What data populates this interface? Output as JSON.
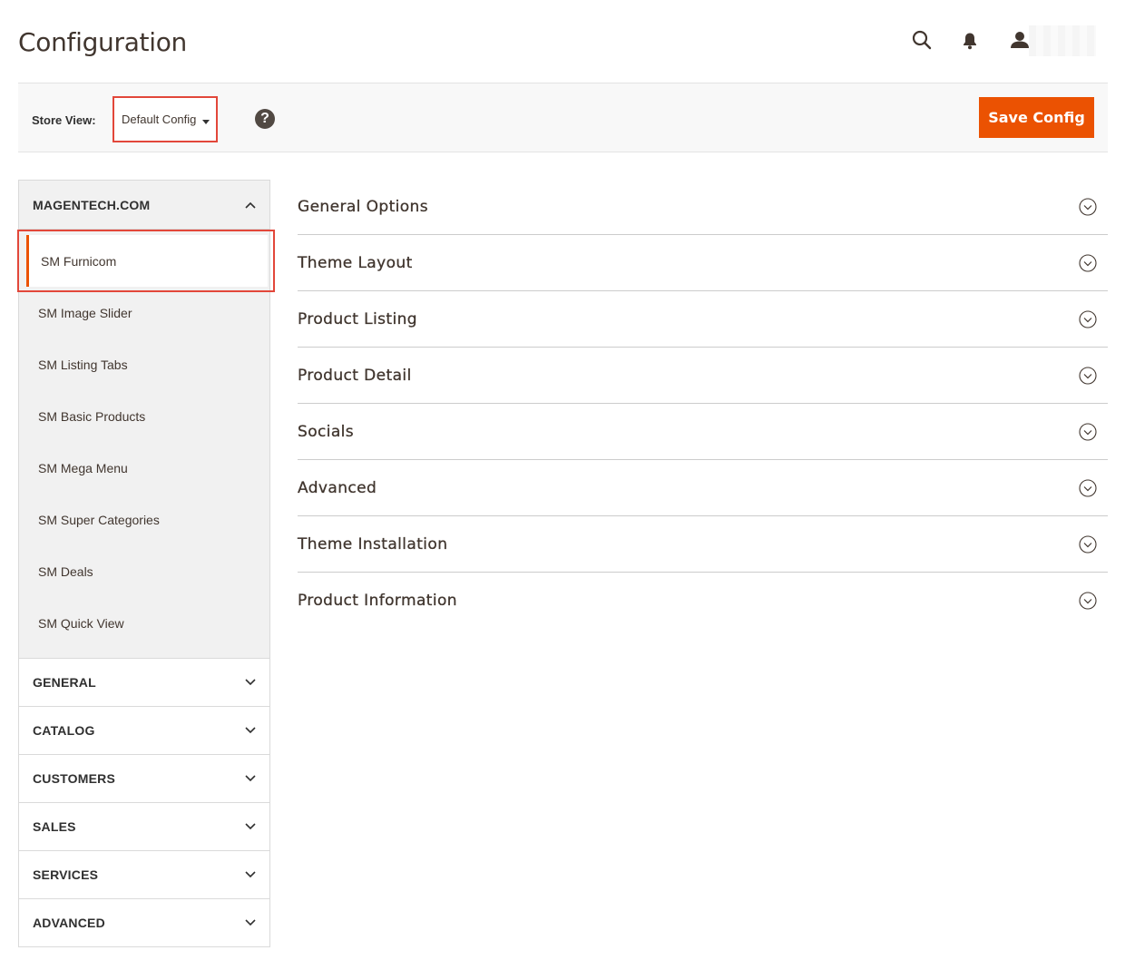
{
  "header": {
    "title": "Configuration",
    "icons": [
      "search-icon",
      "bell-icon",
      "user-icon"
    ]
  },
  "store_bar": {
    "label": "Store View:",
    "selected_scope": "Default Config",
    "help_symbol": "?",
    "save_label": "Save Config",
    "accent_color": "#eb5202",
    "highlight_color": "#e2473a"
  },
  "sidebar": {
    "open_section": {
      "title": "MAGENTECH.COM",
      "items": [
        {
          "label": "SM Furnicom",
          "active": true
        },
        {
          "label": "SM Image Slider"
        },
        {
          "label": "SM Listing Tabs"
        },
        {
          "label": "SM Basic Products"
        },
        {
          "label": "SM Mega Menu"
        },
        {
          "label": "SM Super Categories"
        },
        {
          "label": "SM Deals"
        },
        {
          "label": "SM Quick View"
        }
      ]
    },
    "sections": [
      {
        "title": "GENERAL"
      },
      {
        "title": "CATALOG"
      },
      {
        "title": "CUSTOMERS"
      },
      {
        "title": "SALES"
      },
      {
        "title": "SERVICES"
      },
      {
        "title": "ADVANCED"
      }
    ]
  },
  "groups": [
    {
      "label": "General Options"
    },
    {
      "label": "Theme Layout"
    },
    {
      "label": "Product Listing"
    },
    {
      "label": "Product Detail"
    },
    {
      "label": "Socials"
    },
    {
      "label": "Advanced"
    },
    {
      "label": "Theme Installation"
    },
    {
      "label": "Product Information"
    }
  ]
}
